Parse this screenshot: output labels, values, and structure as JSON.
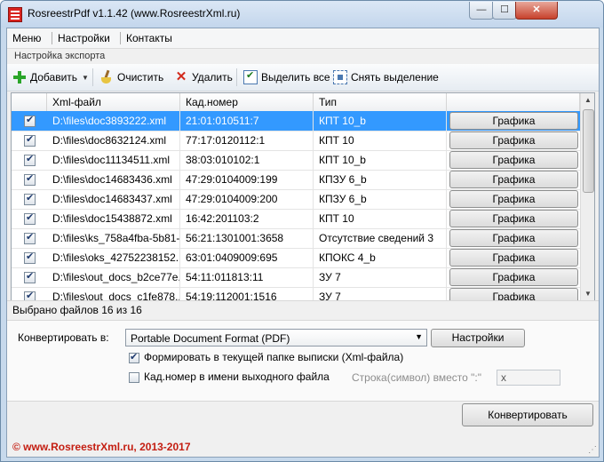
{
  "window": {
    "title": "RosreestrPdf v1.1.42 (www.RosreestrXml.ru)",
    "min_glyph": "—",
    "max_glyph": "☐",
    "close_glyph": "✕"
  },
  "menu": {
    "items": [
      "Меню",
      "Настройки",
      "Контакты"
    ]
  },
  "section_label": "Настройка экспорта",
  "toolbar": {
    "add_label": "Добавить",
    "clear_label": "Очистить",
    "delete_label": "Удалить",
    "select_all_label": "Выделить все",
    "deselect_label": "Снять выделение"
  },
  "grid": {
    "columns": [
      "",
      "Xml-файл",
      "Кад.номер",
      "Тип",
      ""
    ],
    "button_label": "Графика",
    "rows": [
      {
        "checked": true,
        "file": "D:\\files\\doc3893222.xml",
        "cad": "21:01:010511:7",
        "type": "КПТ 10_b",
        "selected": true
      },
      {
        "checked": true,
        "file": "D:\\files\\doc8632124.xml",
        "cad": "77:17:0120112:1",
        "type": "КПТ 10",
        "selected": false
      },
      {
        "checked": true,
        "file": "D:\\files\\doc11134511.xml",
        "cad": "38:03:010102:1",
        "type": "КПТ 10_b",
        "selected": false
      },
      {
        "checked": true,
        "file": "D:\\files\\doc14683436.xml",
        "cad": "47:29:0104009:199",
        "type": "КПЗУ 6_b",
        "selected": false
      },
      {
        "checked": true,
        "file": "D:\\files\\doc14683437.xml",
        "cad": "47:29:0104009:200",
        "type": "КПЗУ 6_b",
        "selected": false
      },
      {
        "checked": true,
        "file": "D:\\files\\doc15438872.xml",
        "cad": "16:42:201103:2",
        "type": "КПТ 10",
        "selected": false
      },
      {
        "checked": true,
        "file": "D:\\files\\ks_758a4fba-5b81-...",
        "cad": "56:21:1301001:3658",
        "type": "Отсутствие сведений 3",
        "selected": false
      },
      {
        "checked": true,
        "file": "D:\\files\\oks_42752238152...",
        "cad": "63:01:0409009:695",
        "type": "КПОКС 4_b",
        "selected": false
      },
      {
        "checked": true,
        "file": "D:\\files\\out_docs_b2ce77e...",
        "cad": "54:11:011813:11",
        "type": "ЗУ 7",
        "selected": false
      },
      {
        "checked": true,
        "file": "D:\\files\\out_docs_c1fe878...",
        "cad": "54:19:112001:1516",
        "type": "ЗУ 7",
        "selected": false
      }
    ]
  },
  "status": "Выбрано файлов 16 из 16",
  "convert": {
    "label": "Конвертировать в:",
    "format_value": "Portable Document Format (PDF)",
    "settings_label": "Настройки",
    "opt_folder_label": "Формировать в текущей папке выписки (Xml-файла)",
    "opt_folder_checked": true,
    "opt_cad_label": "Кад.номер в имени выходного файла",
    "opt_cad_checked": false,
    "replace_label": "Строка(символ) вместо \":\"",
    "replace_value": "x",
    "convert_button": "Конвертировать"
  },
  "footer": "© www.RosreestrXml.ru, 2013-2017"
}
